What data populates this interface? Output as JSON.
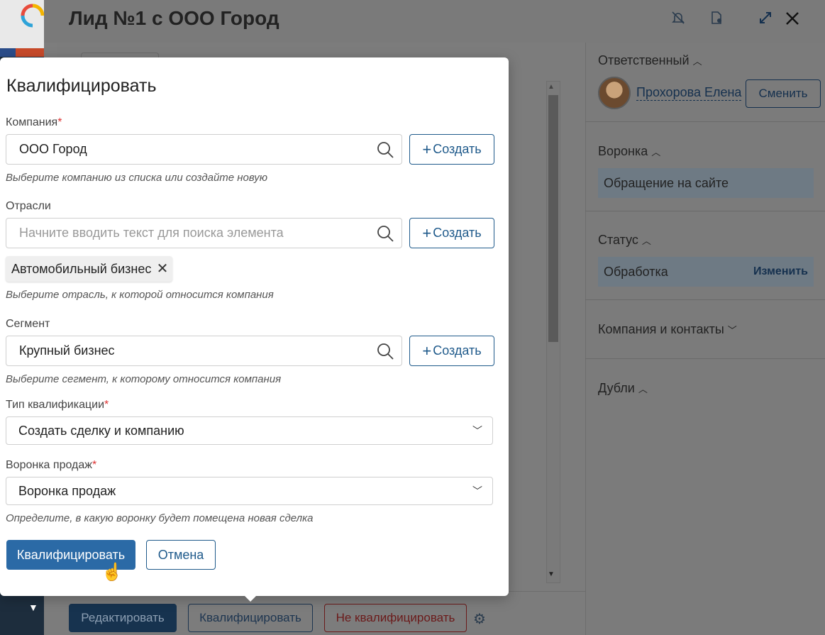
{
  "header": {
    "title": "Лид №1 с ООО Город"
  },
  "footer": {
    "edit_label": "Редактировать",
    "qualify_label": "Квалифицировать",
    "not_qualify_label": "Не квалифицировать"
  },
  "sidebar": {
    "responsible": {
      "title": "Ответственный",
      "name": "Прохорова Елена",
      "change_label": "Сменить"
    },
    "funnel": {
      "title": "Воронка",
      "value": "Обращение на сайте"
    },
    "status": {
      "title": "Статус",
      "value": "Обработка",
      "change_label": "Изменить"
    },
    "companies": {
      "title": "Компания и контакты"
    },
    "duplicates": {
      "title": "Дубли"
    }
  },
  "modal": {
    "title": "Квалифицировать",
    "company": {
      "label": "Компания",
      "required": "*",
      "value": "ООО Город",
      "create_label": "Создать",
      "hint": "Выберите компанию из списка или создайте новую"
    },
    "industries": {
      "label": "Отрасли",
      "placeholder": "Начните вводить текст для поиска элемента",
      "create_label": "Создать",
      "tag": "Автомобильный бизнес",
      "hint": "Выберите отрасль, к которой относится компания"
    },
    "segment": {
      "label": "Сегмент",
      "value": "Крупный бизнес",
      "create_label": "Создать",
      "hint": "Выберите сегмент, к которому относится компания"
    },
    "qualification_type": {
      "label": "Тип квалификации",
      "required": "*",
      "value": "Создать сделку и компанию"
    },
    "sales_funnel": {
      "label": "Воронка продаж",
      "required": "*",
      "value": "Воронка продаж",
      "hint": "Определите, в какую воронку будет помещена новая сделка"
    },
    "submit_label": "Квалифицировать",
    "cancel_label": "Отмена"
  },
  "colors": {
    "primary": "#2b6aa6",
    "accent_outline": "#1f5a8b",
    "required": "#d33333"
  }
}
